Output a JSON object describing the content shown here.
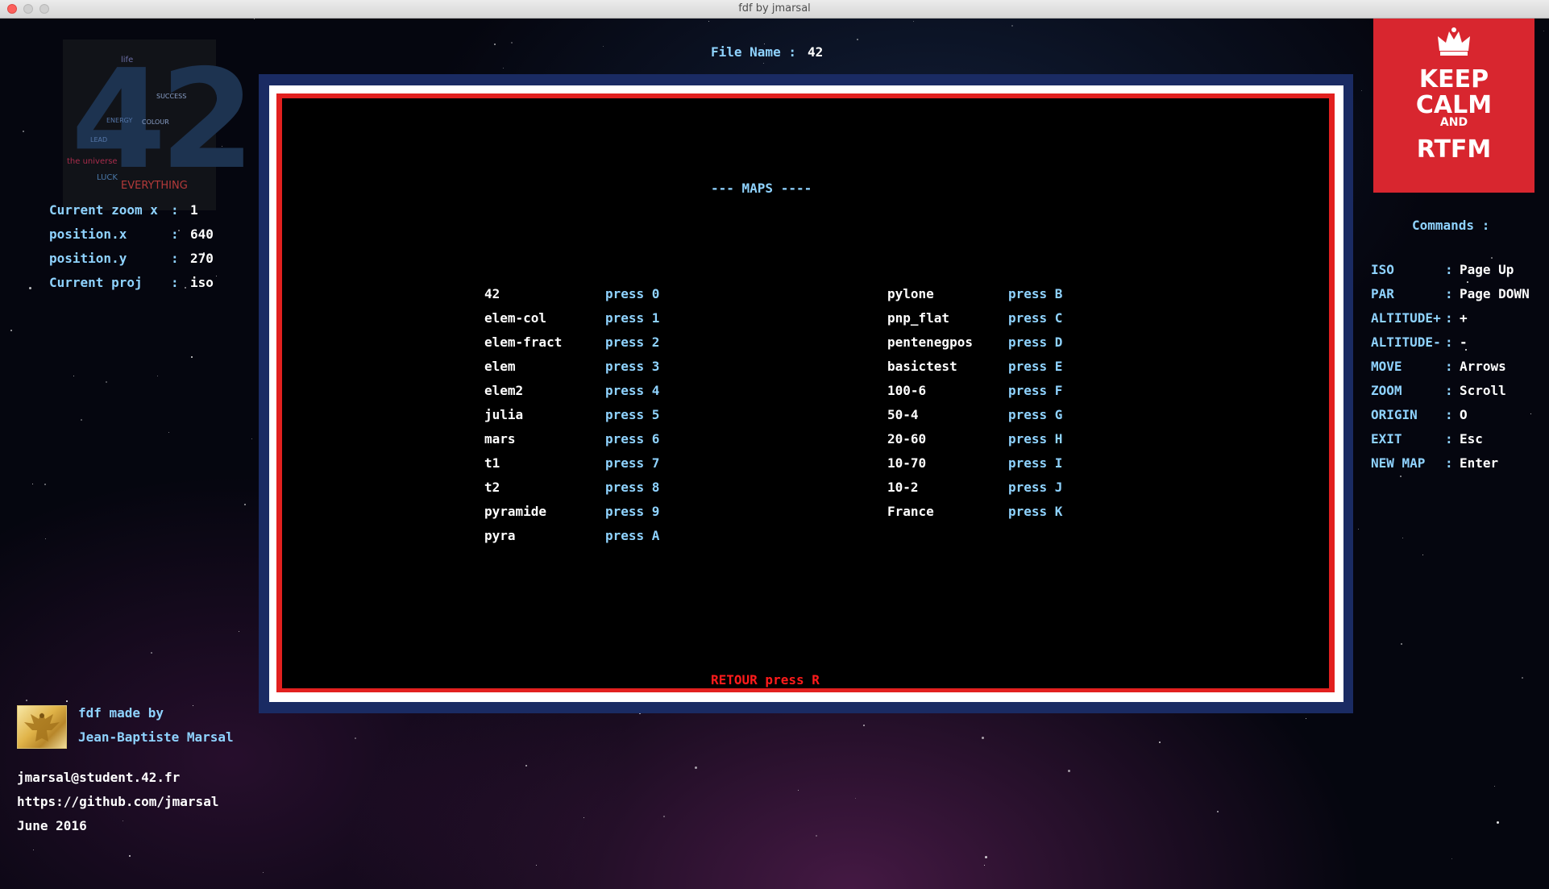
{
  "window": {
    "title": "fdf by jmarsal"
  },
  "header": {
    "file_name_label": "File Name",
    "file_name_value": "42"
  },
  "info": [
    {
      "label": "Current zoom x",
      "value": "1"
    },
    {
      "label": "position.x",
      "value": "640"
    },
    {
      "label": "position.y",
      "value": "270"
    },
    {
      "label": "Current proj",
      "value": "iso"
    }
  ],
  "logo": {
    "number": "42",
    "words": [
      "life",
      "the universe",
      "EVERYTHING",
      "LUCK",
      "SUCCESS",
      "COLOUR",
      "ENERGY",
      "LEAD"
    ]
  },
  "keep_calm": {
    "line1": "KEEP",
    "line2": "CALM",
    "line3": "AND",
    "line4": "RTFM"
  },
  "commands": {
    "title": "Commands :",
    "items": [
      {
        "key": "ISO",
        "value": "Page Up"
      },
      {
        "key": "PAR",
        "value": "Page DOWN"
      },
      {
        "key": "ALTITUDE+",
        "value": "+"
      },
      {
        "key": "ALTITUDE-",
        "value": "-"
      },
      {
        "key": "MOVE",
        "value": "Arrows"
      },
      {
        "key": "ZOOM",
        "value": "Scroll"
      },
      {
        "key": "ORIGIN",
        "value": "O"
      },
      {
        "key": "EXIT",
        "value": "Esc"
      },
      {
        "key": "NEW MAP",
        "value": "Enter"
      }
    ]
  },
  "maps": {
    "title": "--- MAPS ----",
    "left": [
      {
        "name": "42",
        "key": "press 0"
      },
      {
        "name": "elem-col",
        "key": "press 1"
      },
      {
        "name": "elem-fract",
        "key": "press 2"
      },
      {
        "name": "elem",
        "key": "press 3"
      },
      {
        "name": "elem2",
        "key": "press 4"
      },
      {
        "name": "julia",
        "key": "press 5"
      },
      {
        "name": "mars",
        "key": "press 6"
      },
      {
        "name": "t1",
        "key": "press 7"
      },
      {
        "name": "t2",
        "key": "press 8"
      },
      {
        "name": "pyramide",
        "key": "press 9"
      },
      {
        "name": "pyra",
        "key": "press A"
      }
    ],
    "right": [
      {
        "name": "pylone",
        "key": "press B"
      },
      {
        "name": "pnp_flat",
        "key": "press C"
      },
      {
        "name": "pentenegpos",
        "key": "press D"
      },
      {
        "name": "basictest",
        "key": "press E"
      },
      {
        "name": "100-6",
        "key": "press F"
      },
      {
        "name": "50-4",
        "key": "press G"
      },
      {
        "name": "20-60",
        "key": "press H"
      },
      {
        "name": "10-70",
        "key": "press I"
      },
      {
        "name": "10-2",
        "key": "press J"
      },
      {
        "name": "France",
        "key": "press K"
      }
    ],
    "back": "RETOUR press R"
  },
  "credits": {
    "made_by": "fdf made by",
    "author": "Jean-Baptiste Marsal",
    "email": "jmarsal@student.42.fr",
    "github": "https://github.com/jmarsal",
    "date": "June 2016"
  },
  "colors": {
    "label": "#8fd3ff",
    "value": "#ffffff",
    "back": "#ff1b1b",
    "keep_calm_bg": "#d8262f",
    "frame_blue": "#1a2b63",
    "frame_red": "#e2201f"
  }
}
